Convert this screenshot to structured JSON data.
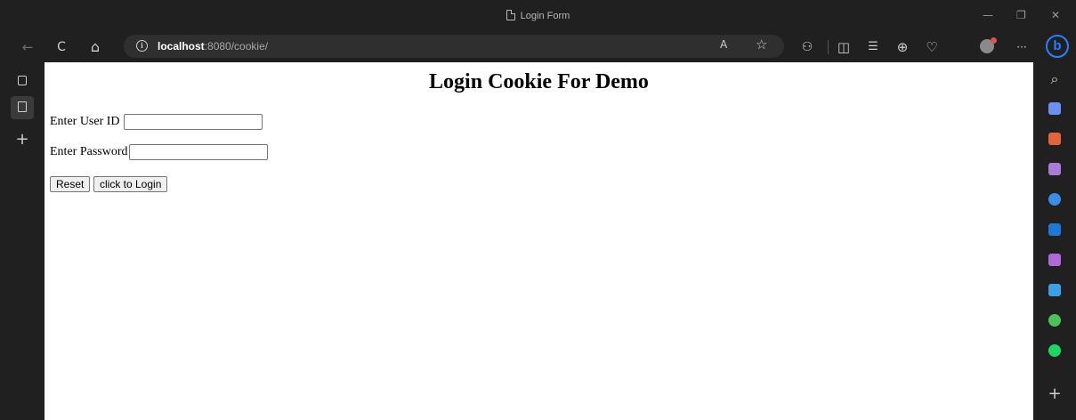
{
  "window": {
    "tab_title": "Login Form",
    "minimize": "—",
    "restore": "❐",
    "close": "✕"
  },
  "toolbar": {
    "back": "←",
    "refresh": "C",
    "home": "⌂",
    "url_host": "localhost",
    "url_path": ":8080/cookie/",
    "read_aloud": "A",
    "favorite": "☆",
    "extensions": "⚇",
    "split_screen": "◫",
    "favorites": "☰",
    "collections": "⊕",
    "health": "♡",
    "more": "···",
    "copilot": "b"
  },
  "left_sidebar": {
    "new_tab": "+"
  },
  "right_sidebar": {
    "search": "⌕",
    "add": "+",
    "apps": [
      {
        "name": "shopping",
        "color": "#6c8ff2"
      },
      {
        "name": "tools",
        "color": "#e0643c"
      },
      {
        "name": "games",
        "color": "#a77bd8"
      },
      {
        "name": "microsoft-365",
        "color": "#3a8ee6"
      },
      {
        "name": "outlook",
        "color": "#1f78d1"
      },
      {
        "name": "designer",
        "color": "#b06ad8"
      },
      {
        "name": "send",
        "color": "#3aa0e8"
      },
      {
        "name": "tree",
        "color": "#4fbf5a"
      },
      {
        "name": "spotify",
        "color": "#1ed760"
      }
    ]
  },
  "page": {
    "heading": "Login Cookie For Demo",
    "user_id_label": "Enter User ID",
    "user_id_value": "",
    "password_label": "Enter Password",
    "password_value": "",
    "reset_button": "Reset",
    "login_button": "click to Login"
  }
}
